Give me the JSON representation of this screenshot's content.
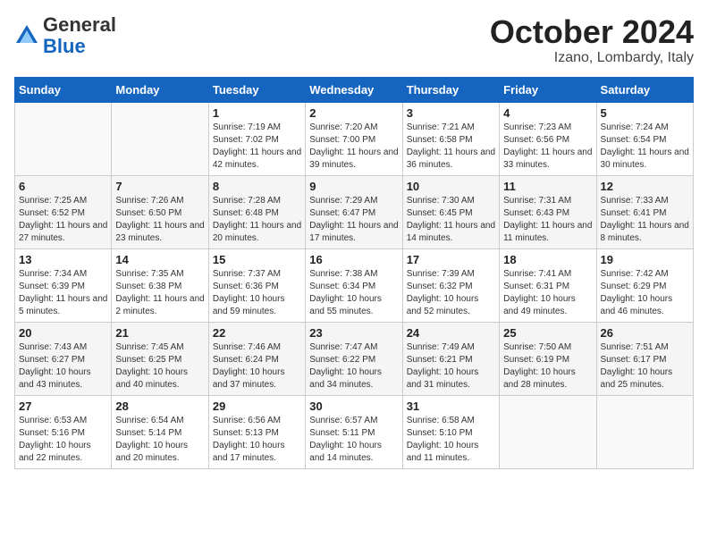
{
  "logo": {
    "general": "General",
    "blue": "Blue"
  },
  "header": {
    "month": "October 2024",
    "location": "Izano, Lombardy, Italy"
  },
  "weekdays": [
    "Sunday",
    "Monday",
    "Tuesday",
    "Wednesday",
    "Thursday",
    "Friday",
    "Saturday"
  ],
  "weeks": [
    [
      {
        "day": "",
        "detail": ""
      },
      {
        "day": "",
        "detail": ""
      },
      {
        "day": "1",
        "detail": "Sunrise: 7:19 AM\nSunset: 7:02 PM\nDaylight: 11 hours and 42 minutes."
      },
      {
        "day": "2",
        "detail": "Sunrise: 7:20 AM\nSunset: 7:00 PM\nDaylight: 11 hours and 39 minutes."
      },
      {
        "day": "3",
        "detail": "Sunrise: 7:21 AM\nSunset: 6:58 PM\nDaylight: 11 hours and 36 minutes."
      },
      {
        "day": "4",
        "detail": "Sunrise: 7:23 AM\nSunset: 6:56 PM\nDaylight: 11 hours and 33 minutes."
      },
      {
        "day": "5",
        "detail": "Sunrise: 7:24 AM\nSunset: 6:54 PM\nDaylight: 11 hours and 30 minutes."
      }
    ],
    [
      {
        "day": "6",
        "detail": "Sunrise: 7:25 AM\nSunset: 6:52 PM\nDaylight: 11 hours and 27 minutes."
      },
      {
        "day": "7",
        "detail": "Sunrise: 7:26 AM\nSunset: 6:50 PM\nDaylight: 11 hours and 23 minutes."
      },
      {
        "day": "8",
        "detail": "Sunrise: 7:28 AM\nSunset: 6:48 PM\nDaylight: 11 hours and 20 minutes."
      },
      {
        "day": "9",
        "detail": "Sunrise: 7:29 AM\nSunset: 6:47 PM\nDaylight: 11 hours and 17 minutes."
      },
      {
        "day": "10",
        "detail": "Sunrise: 7:30 AM\nSunset: 6:45 PM\nDaylight: 11 hours and 14 minutes."
      },
      {
        "day": "11",
        "detail": "Sunrise: 7:31 AM\nSunset: 6:43 PM\nDaylight: 11 hours and 11 minutes."
      },
      {
        "day": "12",
        "detail": "Sunrise: 7:33 AM\nSunset: 6:41 PM\nDaylight: 11 hours and 8 minutes."
      }
    ],
    [
      {
        "day": "13",
        "detail": "Sunrise: 7:34 AM\nSunset: 6:39 PM\nDaylight: 11 hours and 5 minutes."
      },
      {
        "day": "14",
        "detail": "Sunrise: 7:35 AM\nSunset: 6:38 PM\nDaylight: 11 hours and 2 minutes."
      },
      {
        "day": "15",
        "detail": "Sunrise: 7:37 AM\nSunset: 6:36 PM\nDaylight: 10 hours and 59 minutes."
      },
      {
        "day": "16",
        "detail": "Sunrise: 7:38 AM\nSunset: 6:34 PM\nDaylight: 10 hours and 55 minutes."
      },
      {
        "day": "17",
        "detail": "Sunrise: 7:39 AM\nSunset: 6:32 PM\nDaylight: 10 hours and 52 minutes."
      },
      {
        "day": "18",
        "detail": "Sunrise: 7:41 AM\nSunset: 6:31 PM\nDaylight: 10 hours and 49 minutes."
      },
      {
        "day": "19",
        "detail": "Sunrise: 7:42 AM\nSunset: 6:29 PM\nDaylight: 10 hours and 46 minutes."
      }
    ],
    [
      {
        "day": "20",
        "detail": "Sunrise: 7:43 AM\nSunset: 6:27 PM\nDaylight: 10 hours and 43 minutes."
      },
      {
        "day": "21",
        "detail": "Sunrise: 7:45 AM\nSunset: 6:25 PM\nDaylight: 10 hours and 40 minutes."
      },
      {
        "day": "22",
        "detail": "Sunrise: 7:46 AM\nSunset: 6:24 PM\nDaylight: 10 hours and 37 minutes."
      },
      {
        "day": "23",
        "detail": "Sunrise: 7:47 AM\nSunset: 6:22 PM\nDaylight: 10 hours and 34 minutes."
      },
      {
        "day": "24",
        "detail": "Sunrise: 7:49 AM\nSunset: 6:21 PM\nDaylight: 10 hours and 31 minutes."
      },
      {
        "day": "25",
        "detail": "Sunrise: 7:50 AM\nSunset: 6:19 PM\nDaylight: 10 hours and 28 minutes."
      },
      {
        "day": "26",
        "detail": "Sunrise: 7:51 AM\nSunset: 6:17 PM\nDaylight: 10 hours and 25 minutes."
      }
    ],
    [
      {
        "day": "27",
        "detail": "Sunrise: 6:53 AM\nSunset: 5:16 PM\nDaylight: 10 hours and 22 minutes."
      },
      {
        "day": "28",
        "detail": "Sunrise: 6:54 AM\nSunset: 5:14 PM\nDaylight: 10 hours and 20 minutes."
      },
      {
        "day": "29",
        "detail": "Sunrise: 6:56 AM\nSunset: 5:13 PM\nDaylight: 10 hours and 17 minutes."
      },
      {
        "day": "30",
        "detail": "Sunrise: 6:57 AM\nSunset: 5:11 PM\nDaylight: 10 hours and 14 minutes."
      },
      {
        "day": "31",
        "detail": "Sunrise: 6:58 AM\nSunset: 5:10 PM\nDaylight: 10 hours and 11 minutes."
      },
      {
        "day": "",
        "detail": ""
      },
      {
        "day": "",
        "detail": ""
      }
    ]
  ]
}
